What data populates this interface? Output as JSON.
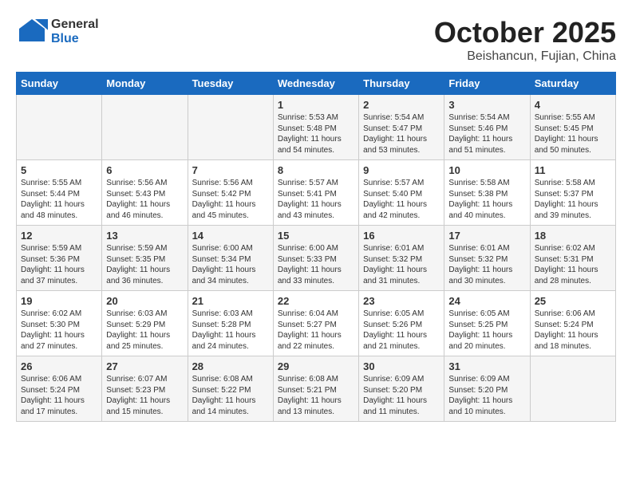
{
  "header": {
    "logo_general": "General",
    "logo_blue": "Blue",
    "month_title": "October 2025",
    "location": "Beishancun, Fujian, China"
  },
  "days_of_week": [
    "Sunday",
    "Monday",
    "Tuesday",
    "Wednesday",
    "Thursday",
    "Friday",
    "Saturday"
  ],
  "weeks": [
    [
      {
        "day": "",
        "info": ""
      },
      {
        "day": "",
        "info": ""
      },
      {
        "day": "",
        "info": ""
      },
      {
        "day": "1",
        "info": "Sunrise: 5:53 AM\nSunset: 5:48 PM\nDaylight: 11 hours\nand 54 minutes."
      },
      {
        "day": "2",
        "info": "Sunrise: 5:54 AM\nSunset: 5:47 PM\nDaylight: 11 hours\nand 53 minutes."
      },
      {
        "day": "3",
        "info": "Sunrise: 5:54 AM\nSunset: 5:46 PM\nDaylight: 11 hours\nand 51 minutes."
      },
      {
        "day": "4",
        "info": "Sunrise: 5:55 AM\nSunset: 5:45 PM\nDaylight: 11 hours\nand 50 minutes."
      }
    ],
    [
      {
        "day": "5",
        "info": "Sunrise: 5:55 AM\nSunset: 5:44 PM\nDaylight: 11 hours\nand 48 minutes."
      },
      {
        "day": "6",
        "info": "Sunrise: 5:56 AM\nSunset: 5:43 PM\nDaylight: 11 hours\nand 46 minutes."
      },
      {
        "day": "7",
        "info": "Sunrise: 5:56 AM\nSunset: 5:42 PM\nDaylight: 11 hours\nand 45 minutes."
      },
      {
        "day": "8",
        "info": "Sunrise: 5:57 AM\nSunset: 5:41 PM\nDaylight: 11 hours\nand 43 minutes."
      },
      {
        "day": "9",
        "info": "Sunrise: 5:57 AM\nSunset: 5:40 PM\nDaylight: 11 hours\nand 42 minutes."
      },
      {
        "day": "10",
        "info": "Sunrise: 5:58 AM\nSunset: 5:38 PM\nDaylight: 11 hours\nand 40 minutes."
      },
      {
        "day": "11",
        "info": "Sunrise: 5:58 AM\nSunset: 5:37 PM\nDaylight: 11 hours\nand 39 minutes."
      }
    ],
    [
      {
        "day": "12",
        "info": "Sunrise: 5:59 AM\nSunset: 5:36 PM\nDaylight: 11 hours\nand 37 minutes."
      },
      {
        "day": "13",
        "info": "Sunrise: 5:59 AM\nSunset: 5:35 PM\nDaylight: 11 hours\nand 36 minutes."
      },
      {
        "day": "14",
        "info": "Sunrise: 6:00 AM\nSunset: 5:34 PM\nDaylight: 11 hours\nand 34 minutes."
      },
      {
        "day": "15",
        "info": "Sunrise: 6:00 AM\nSunset: 5:33 PM\nDaylight: 11 hours\nand 33 minutes."
      },
      {
        "day": "16",
        "info": "Sunrise: 6:01 AM\nSunset: 5:32 PM\nDaylight: 11 hours\nand 31 minutes."
      },
      {
        "day": "17",
        "info": "Sunrise: 6:01 AM\nSunset: 5:32 PM\nDaylight: 11 hours\nand 30 minutes."
      },
      {
        "day": "18",
        "info": "Sunrise: 6:02 AM\nSunset: 5:31 PM\nDaylight: 11 hours\nand 28 minutes."
      }
    ],
    [
      {
        "day": "19",
        "info": "Sunrise: 6:02 AM\nSunset: 5:30 PM\nDaylight: 11 hours\nand 27 minutes."
      },
      {
        "day": "20",
        "info": "Sunrise: 6:03 AM\nSunset: 5:29 PM\nDaylight: 11 hours\nand 25 minutes."
      },
      {
        "day": "21",
        "info": "Sunrise: 6:03 AM\nSunset: 5:28 PM\nDaylight: 11 hours\nand 24 minutes."
      },
      {
        "day": "22",
        "info": "Sunrise: 6:04 AM\nSunset: 5:27 PM\nDaylight: 11 hours\nand 22 minutes."
      },
      {
        "day": "23",
        "info": "Sunrise: 6:05 AM\nSunset: 5:26 PM\nDaylight: 11 hours\nand 21 minutes."
      },
      {
        "day": "24",
        "info": "Sunrise: 6:05 AM\nSunset: 5:25 PM\nDaylight: 11 hours\nand 20 minutes."
      },
      {
        "day": "25",
        "info": "Sunrise: 6:06 AM\nSunset: 5:24 PM\nDaylight: 11 hours\nand 18 minutes."
      }
    ],
    [
      {
        "day": "26",
        "info": "Sunrise: 6:06 AM\nSunset: 5:24 PM\nDaylight: 11 hours\nand 17 minutes."
      },
      {
        "day": "27",
        "info": "Sunrise: 6:07 AM\nSunset: 5:23 PM\nDaylight: 11 hours\nand 15 minutes."
      },
      {
        "day": "28",
        "info": "Sunrise: 6:08 AM\nSunset: 5:22 PM\nDaylight: 11 hours\nand 14 minutes."
      },
      {
        "day": "29",
        "info": "Sunrise: 6:08 AM\nSunset: 5:21 PM\nDaylight: 11 hours\nand 13 minutes."
      },
      {
        "day": "30",
        "info": "Sunrise: 6:09 AM\nSunset: 5:20 PM\nDaylight: 11 hours\nand 11 minutes."
      },
      {
        "day": "31",
        "info": "Sunrise: 6:09 AM\nSunset: 5:20 PM\nDaylight: 11 hours\nand 10 minutes."
      },
      {
        "day": "",
        "info": ""
      }
    ]
  ]
}
